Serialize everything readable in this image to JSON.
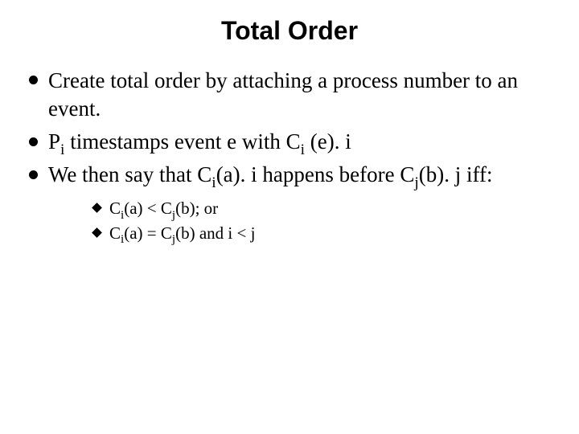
{
  "title": "Total Order",
  "bullets": {
    "b1": "Create total order by attaching a process number to an event.",
    "b2_pre": "P",
    "b2_sub1": "i",
    "b2_mid1": " timestamps event e with C",
    "b2_sub2": "i",
    "b2_mid2": " (e). i",
    "b3_pre": "We then say that C",
    "b3_sub1": "i",
    "b3_mid1": "(a). i happens before C",
    "b3_sub2": "j",
    "b3_mid2": "(b). j iff:"
  },
  "subbullets": {
    "s1_pre": "C",
    "s1_sub1": "i",
    "s1_mid1": "(a) < C",
    "s1_sub2": "j",
    "s1_mid2": "(b); or",
    "s2_pre": "C",
    "s2_sub1": "i",
    "s2_mid1": "(a) = C",
    "s2_sub2": "j",
    "s2_mid2": "(b) and i < j"
  }
}
